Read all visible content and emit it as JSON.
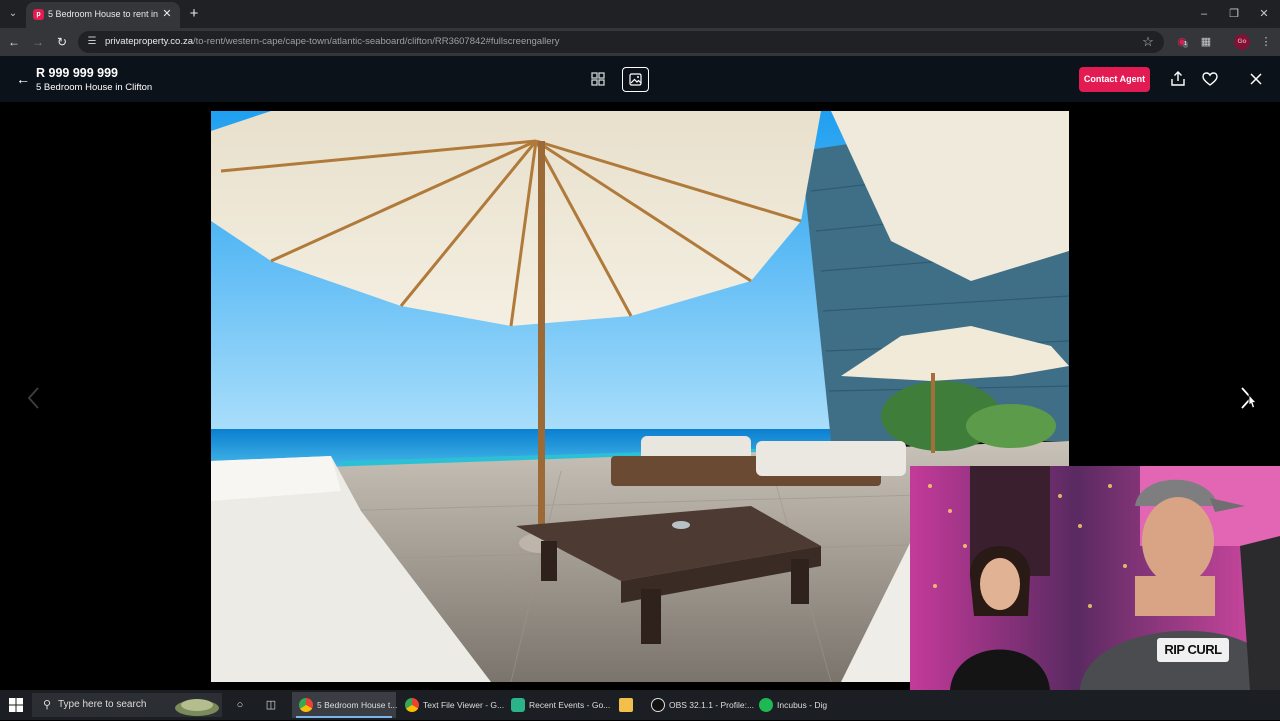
{
  "browser": {
    "tab_title": "5 Bedroom House to rent in Clifton",
    "url_host": "privateproperty.co.za",
    "url_path": "/to-rent/western-cape/cape-town/atlantic-seaboard/clifton/RR3607842#fullscreengallery",
    "profile_initials": "Go",
    "extension_badge": "1"
  },
  "listing": {
    "price": "R 999 999 999",
    "title": "5 Bedroom House in Clifton",
    "contact_label": "Contact Agent"
  },
  "webcam": {
    "shirt_text": "RIP CURL"
  },
  "taskbar": {
    "search_placeholder": "Type here to search",
    "tasks": [
      {
        "label": "5 Bedroom House t..."
      },
      {
        "label": "Text File Viewer - G..."
      },
      {
        "label": "Recent Events - Go..."
      },
      {
        "label": ""
      },
      {
        "label": "OBS 32.1.1 - Profile:..."
      },
      {
        "label": "Incubus - Dig"
      }
    ]
  },
  "colors": {
    "brand": "#e31b53",
    "header_bg": "#0c1219"
  }
}
